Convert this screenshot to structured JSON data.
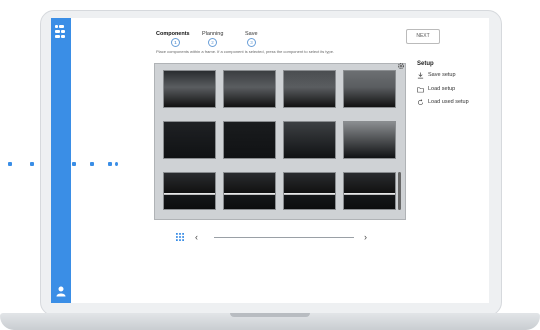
{
  "header": {
    "steps": [
      {
        "label": "Components",
        "number": "1",
        "active": true
      },
      {
        "label": "Planning",
        "number": "2",
        "active": false
      },
      {
        "label": "Save",
        "number": "3",
        "active": false
      }
    ],
    "instruction": "Place components within a frame. If a component is selected, press the component to select its type.",
    "next_label": "NEXT"
  },
  "setup": {
    "title": "Setup",
    "items": [
      {
        "label": "Save setup",
        "icon": "save-icon"
      },
      {
        "label": "Load setup",
        "icon": "folder-icon"
      },
      {
        "label": "Load used setup",
        "icon": "refresh-icon"
      }
    ]
  },
  "grid": {
    "rows": 3,
    "columns": 4,
    "tiles": [
      {
        "shade": "#2a2d30"
      },
      {
        "shade": "#3b3e41"
      },
      {
        "shade": "#4a4d50"
      },
      {
        "shade": "#6c6f72"
      },
      {
        "shade": "#1f2124"
      },
      {
        "shade": "#1a1c1e"
      },
      {
        "shade": "#3d4043"
      },
      {
        "shade": "#8a8d90"
      },
      {
        "shade": "#1d1f22"
      },
      {
        "shade": "#222427"
      },
      {
        "shade": "#2b2d30"
      },
      {
        "shade": "#4c4f52"
      }
    ]
  },
  "colors": {
    "accent": "#3a8ee6",
    "sidebar": "#3a8ee6"
  }
}
